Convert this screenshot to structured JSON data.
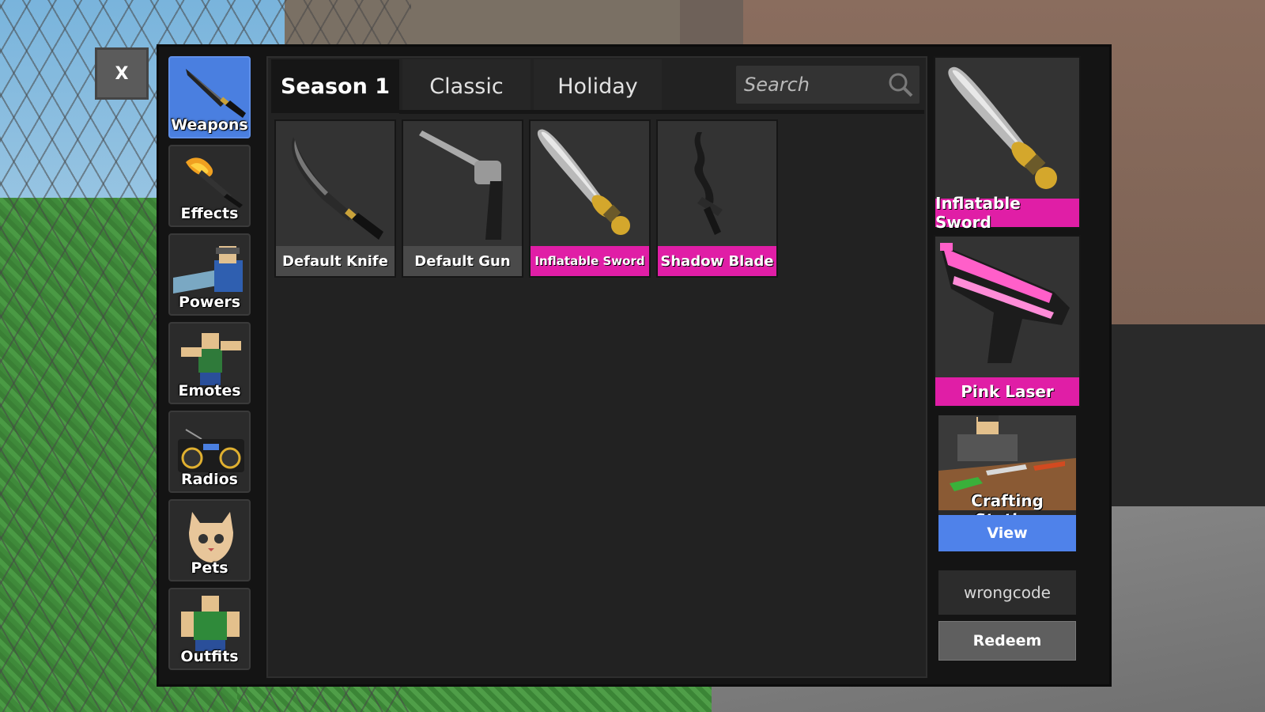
{
  "close": {
    "label": "X"
  },
  "sidebar": {
    "items": [
      {
        "label": "Weapons",
        "icon": "knife-icon",
        "active": true
      },
      {
        "label": "Effects",
        "icon": "flame-knife-icon",
        "active": false
      },
      {
        "label": "Powers",
        "icon": "power-character-icon",
        "active": false
      },
      {
        "label": "Emotes",
        "icon": "emote-character-icon",
        "active": false
      },
      {
        "label": "Radios",
        "icon": "boombox-icon",
        "active": false
      },
      {
        "label": "Pets",
        "icon": "cat-icon",
        "active": false
      },
      {
        "label": "Outfits",
        "icon": "outfit-character-icon",
        "active": false
      }
    ]
  },
  "tabs": [
    {
      "label": "Season 1",
      "active": true
    },
    {
      "label": "Classic",
      "active": false
    },
    {
      "label": "Holiday",
      "active": false
    }
  ],
  "search": {
    "placeholder": "Search",
    "value": "",
    "icon": "search-icon"
  },
  "inventory": [
    {
      "name": "Default Knife",
      "icon": "knife-icon",
      "rarity_color": "#4a4a4a"
    },
    {
      "name": "Default Gun",
      "icon": "revolver-icon",
      "rarity_color": "#4a4a4a"
    },
    {
      "name": "Inflatable Sword",
      "icon": "sword-icon",
      "rarity_color": "#e01ea6"
    },
    {
      "name": "Shadow Blade",
      "icon": "shadow-blade-icon",
      "rarity_color": "#e01ea6"
    }
  ],
  "equipped": [
    {
      "name": "Inflatable Sword",
      "icon": "sword-icon"
    },
    {
      "name": "Pink Laser",
      "icon": "laser-gun-icon"
    }
  ],
  "crafting": {
    "title": "Crafting Station",
    "button": "View"
  },
  "redeem": {
    "code_value": "wrongcode",
    "button": "Redeem"
  },
  "colors": {
    "accent_blue": "#4f82ea",
    "rarity_pink": "#e01ea6",
    "panel": "#141414"
  }
}
